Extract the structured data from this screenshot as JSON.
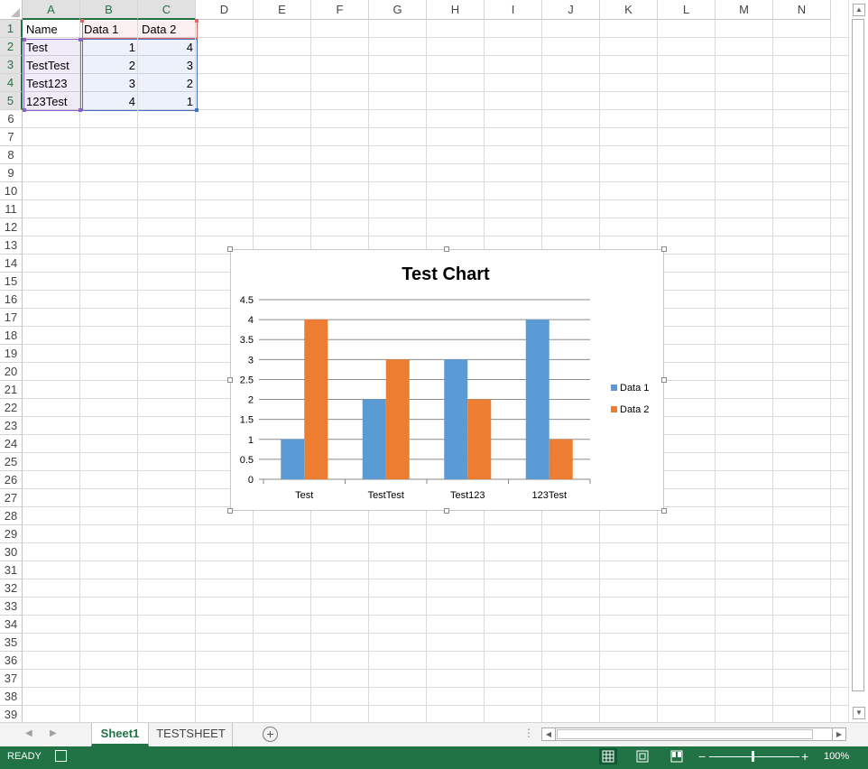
{
  "spreadsheet": {
    "columns": [
      "A",
      "B",
      "C",
      "D",
      "E",
      "F",
      "G",
      "H",
      "I",
      "J",
      "K",
      "L",
      "M",
      "N"
    ],
    "rows": [
      "1",
      "2",
      "3",
      "4",
      "5",
      "6",
      "7",
      "8",
      "9",
      "10",
      "11",
      "12",
      "13",
      "14",
      "15",
      "16",
      "17",
      "18",
      "19",
      "20",
      "21",
      "22",
      "23",
      "24",
      "25",
      "26",
      "27",
      "28",
      "29",
      "30",
      "31",
      "32",
      "33",
      "34",
      "35",
      "36",
      "37",
      "38",
      "39"
    ],
    "table": {
      "headers": [
        "Name",
        "Data 1",
        "Data 2"
      ],
      "rows": [
        [
          "Test",
          "1",
          "4"
        ],
        [
          "TestTest",
          "2",
          "3"
        ],
        [
          "Test123",
          "3",
          "2"
        ],
        [
          "123Test",
          "4",
          "1"
        ]
      ]
    }
  },
  "chart_data": {
    "type": "bar",
    "title": "Test Chart",
    "categories": [
      "Test",
      "TestTest",
      "Test123",
      "123Test"
    ],
    "series": [
      {
        "name": "Data 1",
        "values": [
          1,
          2,
          3,
          4
        ],
        "color": "#5b9bd5"
      },
      {
        "name": "Data 2",
        "values": [
          4,
          3,
          2,
          1
        ],
        "color": "#ed7d31"
      }
    ],
    "ylim": [
      0,
      4.5
    ],
    "yticks": [
      "0",
      "0.5",
      "1",
      "1.5",
      "2",
      "2.5",
      "3",
      "3.5",
      "4",
      "4.5"
    ],
    "grid": true,
    "legend": "right",
    "xlabel": "",
    "ylabel": ""
  },
  "sheet_tabs": {
    "tabs": [
      "Sheet1",
      "TESTSHEET"
    ],
    "active": "Sheet1",
    "add_icon": "plus-circle-icon"
  },
  "status_bar": {
    "status": "READY",
    "zoom": "100%"
  },
  "colors": {
    "accent": "#217346"
  }
}
